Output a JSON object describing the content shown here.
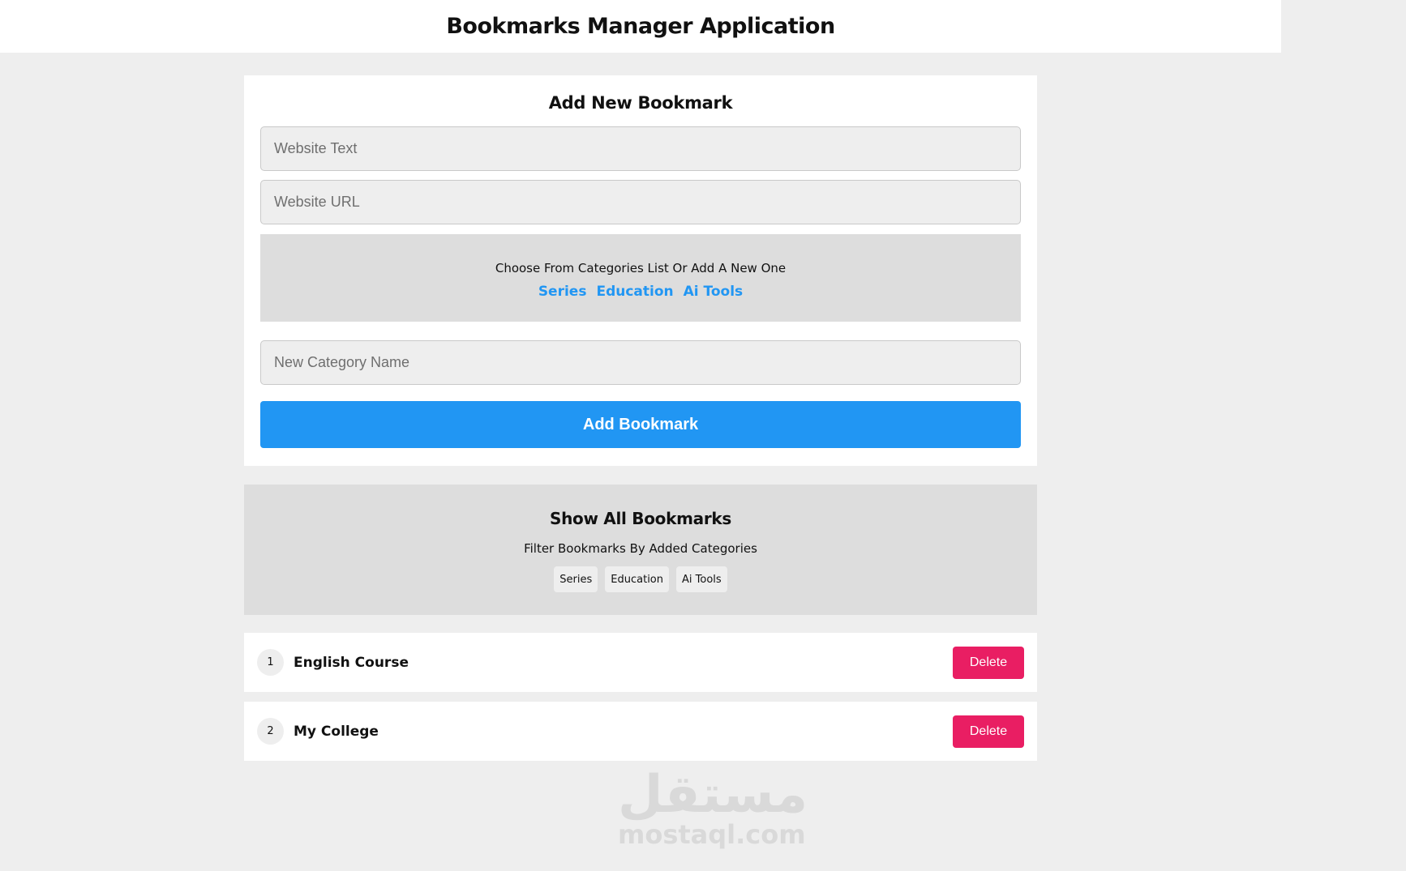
{
  "header": {
    "title": "Bookmarks Manager Application"
  },
  "add_form": {
    "title": "Add New Bookmark",
    "website_text_placeholder": "Website Text",
    "website_url_placeholder": "Website URL",
    "categories_hint": "Choose From Categories List Or Add A New One",
    "categories": [
      "Series",
      "Education",
      "Ai Tools"
    ],
    "new_category_placeholder": "New Category Name",
    "submit_label": "Add Bookmark"
  },
  "show_all": {
    "title": "Show All Bookmarks",
    "filter_hint": "Filter Bookmarks By Added Categories",
    "filters": [
      "Series",
      "Education",
      "Ai Tools"
    ]
  },
  "bookmarks": [
    {
      "number": "1",
      "name": "English Course",
      "delete_label": "Delete"
    },
    {
      "number": "2",
      "name": "My College",
      "delete_label": "Delete"
    }
  ],
  "watermark": {
    "arabic": "مستقل",
    "latin": "mostaql.com"
  },
  "colors": {
    "accent": "#2196f3",
    "danger": "#e91e63",
    "page_background": "#eeeeee",
    "panel_gray": "#dddddd"
  }
}
